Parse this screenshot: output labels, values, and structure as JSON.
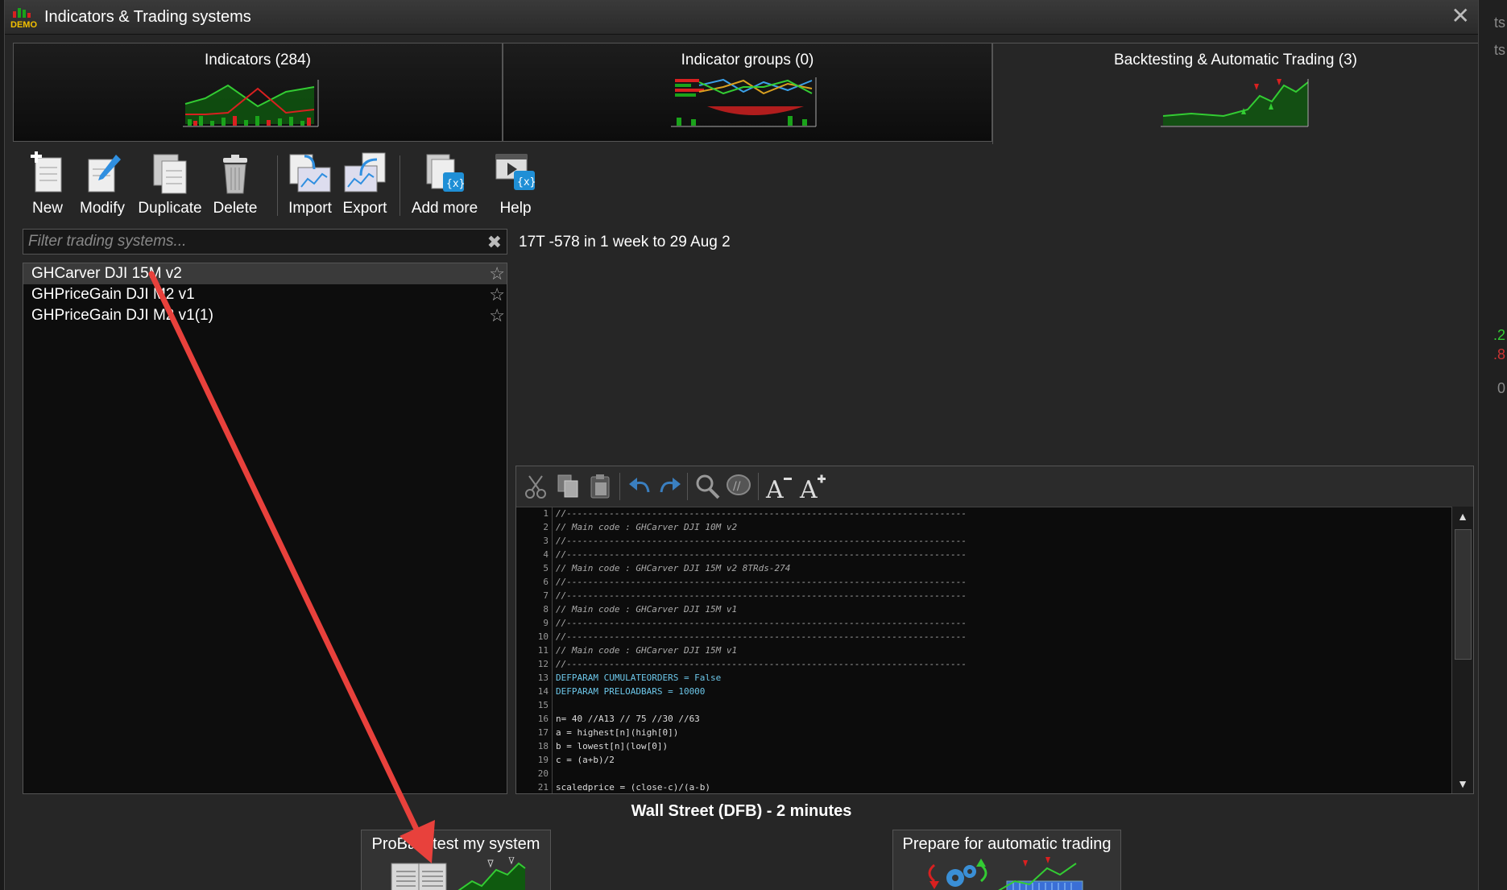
{
  "window": {
    "title": "Indicators & Trading systems",
    "logo_text": "DEMO",
    "close_glyph": "✕"
  },
  "background_strip": {
    "texts": [
      "ts",
      "ts",
      ".2",
      ".8",
      "0"
    ]
  },
  "tabs": [
    {
      "label": "Indicators (284)",
      "active": false
    },
    {
      "label": "Indicator groups (0)",
      "active": false
    },
    {
      "label": "Backtesting & Automatic Trading (3)",
      "active": true
    }
  ],
  "toolbar": {
    "new_label": "New",
    "modify_label": "Modify",
    "duplicate_label": "Duplicate",
    "delete_label": "Delete",
    "import_label": "Import",
    "export_label": "Export",
    "add_more_label": "Add more",
    "help_label": "Help"
  },
  "filter": {
    "placeholder": "Filter trading systems...",
    "value": "",
    "clear_glyph": "✖"
  },
  "systems": [
    {
      "name": "GHCarver DJI 15M v2",
      "selected": true,
      "star": "☆"
    },
    {
      "name": "GHPriceGain DJI M2 v1",
      "selected": false,
      "star": "☆"
    },
    {
      "name": "GHPriceGain DJI M2 v1(1)",
      "selected": false,
      "star": "☆"
    }
  ],
  "summary": "17T -578 in 1 week to 29 Aug 2",
  "code_lines": [
    {
      "n": "1",
      "text": "//---------------------------------------------------------------------------",
      "cls": ""
    },
    {
      "n": "2",
      "text": "// Main code : GHCarver DJI 10M v2",
      "cls": ""
    },
    {
      "n": "3",
      "text": "//---------------------------------------------------------------------------",
      "cls": ""
    },
    {
      "n": "4",
      "text": "//---------------------------------------------------------------------------",
      "cls": ""
    },
    {
      "n": "5",
      "text": "// Main code : GHCarver DJI 15M v2 8TRds-274",
      "cls": ""
    },
    {
      "n": "6",
      "text": "//---------------------------------------------------------------------------",
      "cls": ""
    },
    {
      "n": "7",
      "text": "//---------------------------------------------------------------------------",
      "cls": ""
    },
    {
      "n": "8",
      "text": "// Main code : GHCarver DJI 15M v1",
      "cls": ""
    },
    {
      "n": "9",
      "text": "//---------------------------------------------------------------------------",
      "cls": ""
    },
    {
      "n": "10",
      "text": "//---------------------------------------------------------------------------",
      "cls": ""
    },
    {
      "n": "11",
      "text": "// Main code : GHCarver DJI 15M v1",
      "cls": ""
    },
    {
      "n": "12",
      "text": "//---------------------------------------------------------------------------",
      "cls": ""
    },
    {
      "n": "13",
      "text": "DEFPARAM CUMULATEORDERS = False",
      "cls": "kw"
    },
    {
      "n": "14",
      "text": "DEFPARAM PRELOADBARS = 10000",
      "cls": "kw"
    },
    {
      "n": "15",
      "text": "",
      "cls": "plain"
    },
    {
      "n": "16",
      "text": "n= 40 //A13 // 75 //30 //63",
      "cls": "plain"
    },
    {
      "n": "17",
      "text": "a = highest[n](high[0])",
      "cls": "plain"
    },
    {
      "n": "18",
      "text": "b = lowest[n](low[0])",
      "cls": "plain"
    },
    {
      "n": "19",
      "text": "c = (a+b)/2",
      "cls": "plain"
    },
    {
      "n": "20",
      "text": "",
      "cls": "plain"
    },
    {
      "n": "21",
      "text": "scaledprice = (close-c)/(a-b)",
      "cls": "plain"
    }
  ],
  "scroll": {
    "up_glyph": "▲",
    "down_glyph": "▼"
  },
  "instrument": "Wall Street (DFB) - 2 minutes",
  "actions": {
    "probacktest_label": "ProBacktest my system",
    "prepare_label": "Prepare for automatic trading"
  },
  "colors": {
    "arrow": "#e8413c",
    "chart_green": "#1aa31a",
    "chart_red": "#d92020",
    "accent_blue": "#1f8fd6"
  }
}
